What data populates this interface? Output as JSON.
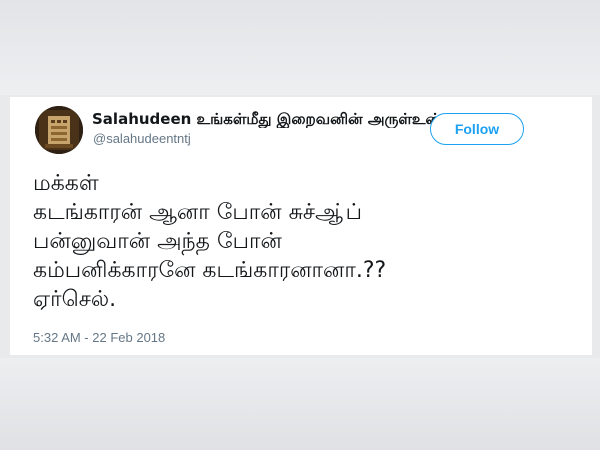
{
  "tweet": {
    "display_name": "Salahudeen உங்கள்மீது இறைவனின் அருள்உண்டாக",
    "handle": "@salahudeentntj",
    "follow_label": "Follow",
    "text_lines": [
      "மக்கள்",
      "கடங்காரன் ஆனா போன் சுச்ஆ்ப்",
      "பன்னுவான் அந்த போன்",
      "கம்பனிக்காரனே கடங்காரனானா.??",
      "ஏர்செல்."
    ],
    "timestamp": "5:32 AM - 22 Feb 2018"
  },
  "colors": {
    "accent": "#1da1f2",
    "text": "#14171a",
    "muted": "#657786",
    "card": "#ffffff",
    "background": "#e9eaec"
  },
  "icons": {
    "avatar": "avatar-image"
  }
}
